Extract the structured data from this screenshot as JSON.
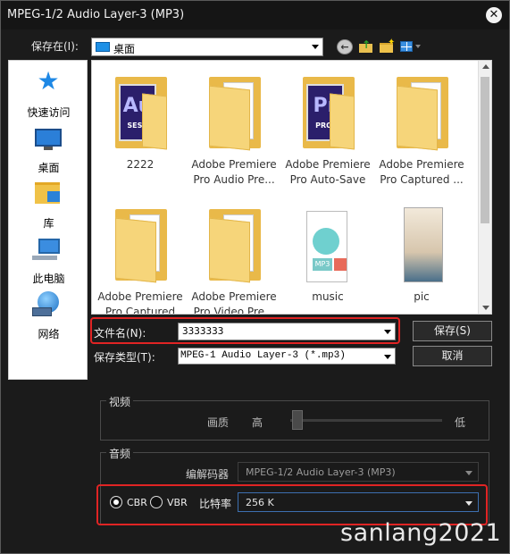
{
  "window": {
    "title": "MPEG-1/2 Audio Layer-3 (MP3)",
    "close_glyph": "✕"
  },
  "save_in": {
    "label": "保存在(I):",
    "value": "桌面"
  },
  "places": [
    {
      "label": "快速访问",
      "icon": "star-icon"
    },
    {
      "label": "桌面",
      "icon": "desktop-icon"
    },
    {
      "label": "库",
      "icon": "library-icon"
    },
    {
      "label": "此电脑",
      "icon": "computer-icon"
    },
    {
      "label": "网络",
      "icon": "network-icon"
    }
  ],
  "files": [
    {
      "name": "2222",
      "type": "audition-folder",
      "badge": "Au",
      "badge_sub": "SESX"
    },
    {
      "name": "Adobe Premiere Pro Audio Pre...",
      "type": "folder"
    },
    {
      "name": "Adobe Premiere Pro Auto-Save",
      "type": "premiere-folder",
      "badge": "Pr",
      "badge_sub": "PROJ"
    },
    {
      "name": "Adobe Premiere Pro Captured ...",
      "type": "folder"
    },
    {
      "name": "Adobe Premiere Pro Captured",
      "type": "folder"
    },
    {
      "name": "Adobe Premiere Pro Video Pre...",
      "type": "folder"
    },
    {
      "name": "music",
      "type": "music-folder",
      "badge": "MP3"
    },
    {
      "name": "pic",
      "type": "picture-folder"
    }
  ],
  "filename": {
    "label": "文件名(N):",
    "value": "3333333"
  },
  "filetype": {
    "label": "保存类型(T):",
    "value": "MPEG-1 Audio Layer-3 (*.mp3)"
  },
  "buttons": {
    "save": "保存(S)",
    "cancel": "取消"
  },
  "video": {
    "title": "视频",
    "quality_label": "画质",
    "high": "高",
    "low": "低",
    "quality_level": 0
  },
  "audio": {
    "title": "音频",
    "codec_label": "编解码器",
    "codec_value": "MPEG-1/2 Audio Layer-3 (MP3)",
    "cbr_label": "CBR",
    "vbr_label": "VBR",
    "cbr_selected": true,
    "bitrate_label": "比特率",
    "bitrate_value": "256 K"
  },
  "watermark": "sanlang2021",
  "colors": {
    "highlight": "#e02424",
    "accent": "#1e88e5"
  }
}
